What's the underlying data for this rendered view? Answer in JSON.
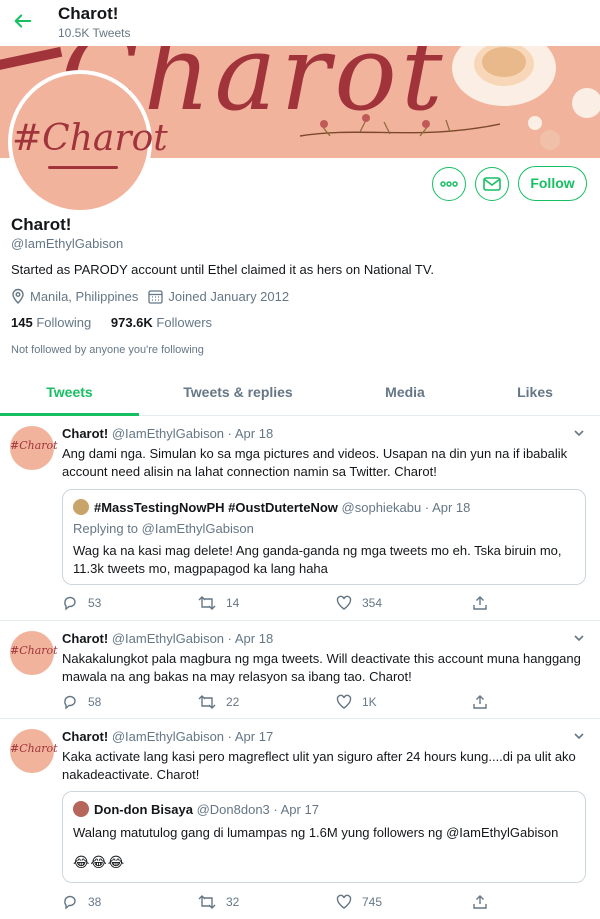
{
  "topbar": {
    "title": "Charot!",
    "tweet_count": "10.5K Tweets"
  },
  "banner": {
    "text": "Charot"
  },
  "avatar": {
    "text": "#Charot"
  },
  "actions": {
    "follow_label": "Follow"
  },
  "profile": {
    "name": "Charot!",
    "handle": "@IamEthylGabison",
    "bio": "Started as PARODY account until Ethel claimed it as hers on National TV.",
    "location": "Manila, Philippines",
    "joined": "Joined January 2012",
    "following_count": "145",
    "following_label": "Following",
    "followers_count": "973.6K",
    "followers_label": "Followers",
    "note": "Not followed by anyone you're following"
  },
  "tabs": [
    {
      "label": "Tweets"
    },
    {
      "label": "Tweets & replies"
    },
    {
      "label": "Media"
    },
    {
      "label": "Likes"
    }
  ],
  "tweets": [
    {
      "avatar_text": "#Charot",
      "name": "Charot!",
      "meta": "@IamEthylGabison · Apr 18",
      "text": "Ang dami nga. Simulan ko sa mga pictures and videos. Usapan na din yun na if ibabalik account need alisin na lahat connection namin sa Twitter. Charot!",
      "quote": {
        "name": "#MassTestingNowPH #OustDuterteNow",
        "meta": "@sophiekabu · Apr 18",
        "replying": "Replying to @IamEthylGabison",
        "text": "Wag ka na kasi mag delete! Ang ganda-ganda ng mga tweets mo eh. Tska biruin mo, 11.3k tweets mo, magpapagod ka lang haha"
      },
      "replies": "53",
      "retweets": "14",
      "likes": "354"
    },
    {
      "avatar_text": "#Charot",
      "name": "Charot!",
      "meta": "@IamEthylGabison · Apr 18",
      "text": "Nakakalungkot pala magbura ng mga tweets. Will deactivate this account muna hanggang mawala na ang bakas na may relasyon sa ibang tao. Charot!",
      "replies": "58",
      "retweets": "22",
      "likes": "1K"
    },
    {
      "avatar_text": "#Charot",
      "name": "Charot!",
      "meta": "@IamEthylGabison · Apr 17",
      "text": "Kaka activate lang kasi pero magreflect ulit yan siguro after 24 hours kung....di pa ulit ako nakadeactivate. Charot!",
      "quote": {
        "name": "Don-don Bisaya",
        "meta": "@Don8don3 · Apr 17",
        "text": "Walang matutulog gang di lumampas ng 1.6M yung followers ng @IamEthylGabison",
        "emoji": "😂😂😂"
      },
      "replies": "38",
      "retweets": "32",
      "likes": "745"
    }
  ]
}
